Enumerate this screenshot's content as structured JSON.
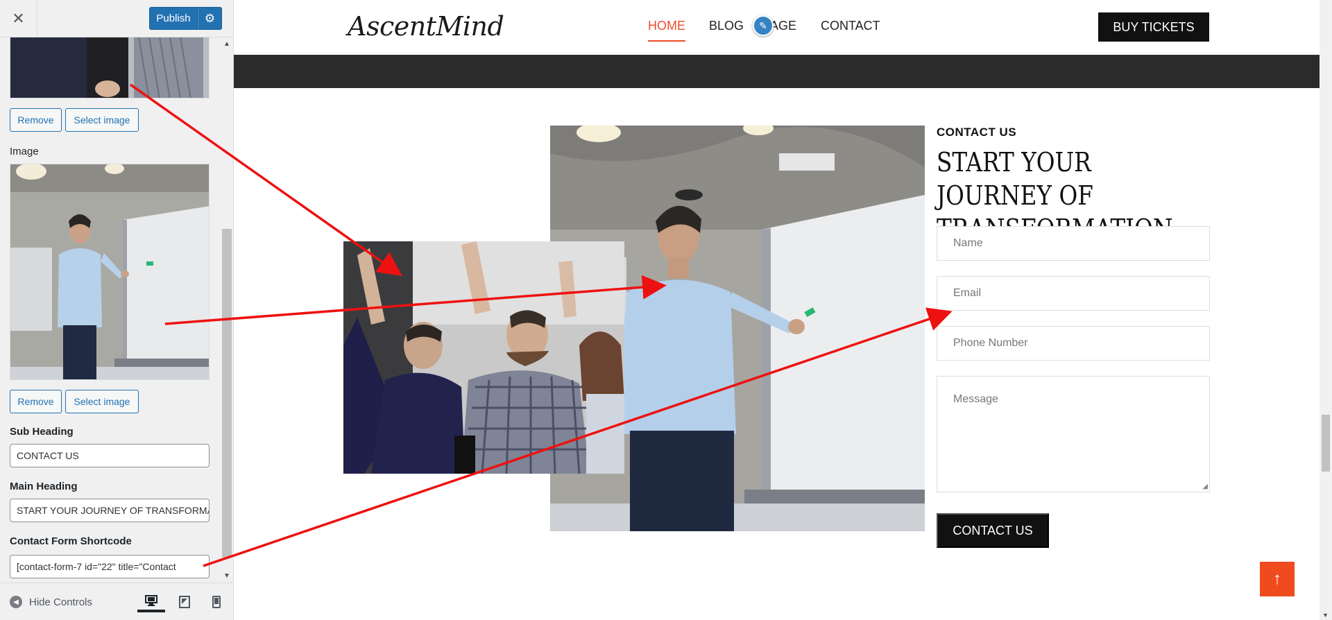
{
  "customizer": {
    "close_icon": "close-icon",
    "publish_label": "Publish",
    "publish_settings_icon": "gear-icon",
    "image_label": "Image",
    "remove_label": "Remove",
    "select_image_label": "Select image",
    "sub_heading_label": "Sub Heading",
    "sub_heading_value": "CONTACT US",
    "main_heading_label": "Main Heading",
    "main_heading_value": "START YOUR JOURNEY OF TRANSFORMATION",
    "shortcode_label": "Contact Form Shortcode",
    "shortcode_value": "[contact-form-7 id=\"22\" title=\"Contact",
    "hide_controls_label": "Hide Controls",
    "devices": [
      "desktop-icon",
      "tablet-icon",
      "mobile-icon"
    ]
  },
  "site": {
    "logo": "AscentMind",
    "nav": [
      "HOME",
      "BLOG",
      "AGE",
      "CONTACT"
    ],
    "buy_tickets": "BUY TICKETS",
    "contact_sub": "CONTACT US",
    "contact_title": "START YOUR JOURNEY OF TRANSFORMATION",
    "form": {
      "name_placeholder": "Name",
      "email_placeholder": "Email",
      "phone_placeholder": "Phone Number",
      "message_placeholder": "Message",
      "submit": "CONTACT US"
    }
  },
  "colors": {
    "accent": "#ef4b2b",
    "wp_blue": "#2271b1",
    "dark": "#111111",
    "arrow": "#ee1111"
  }
}
